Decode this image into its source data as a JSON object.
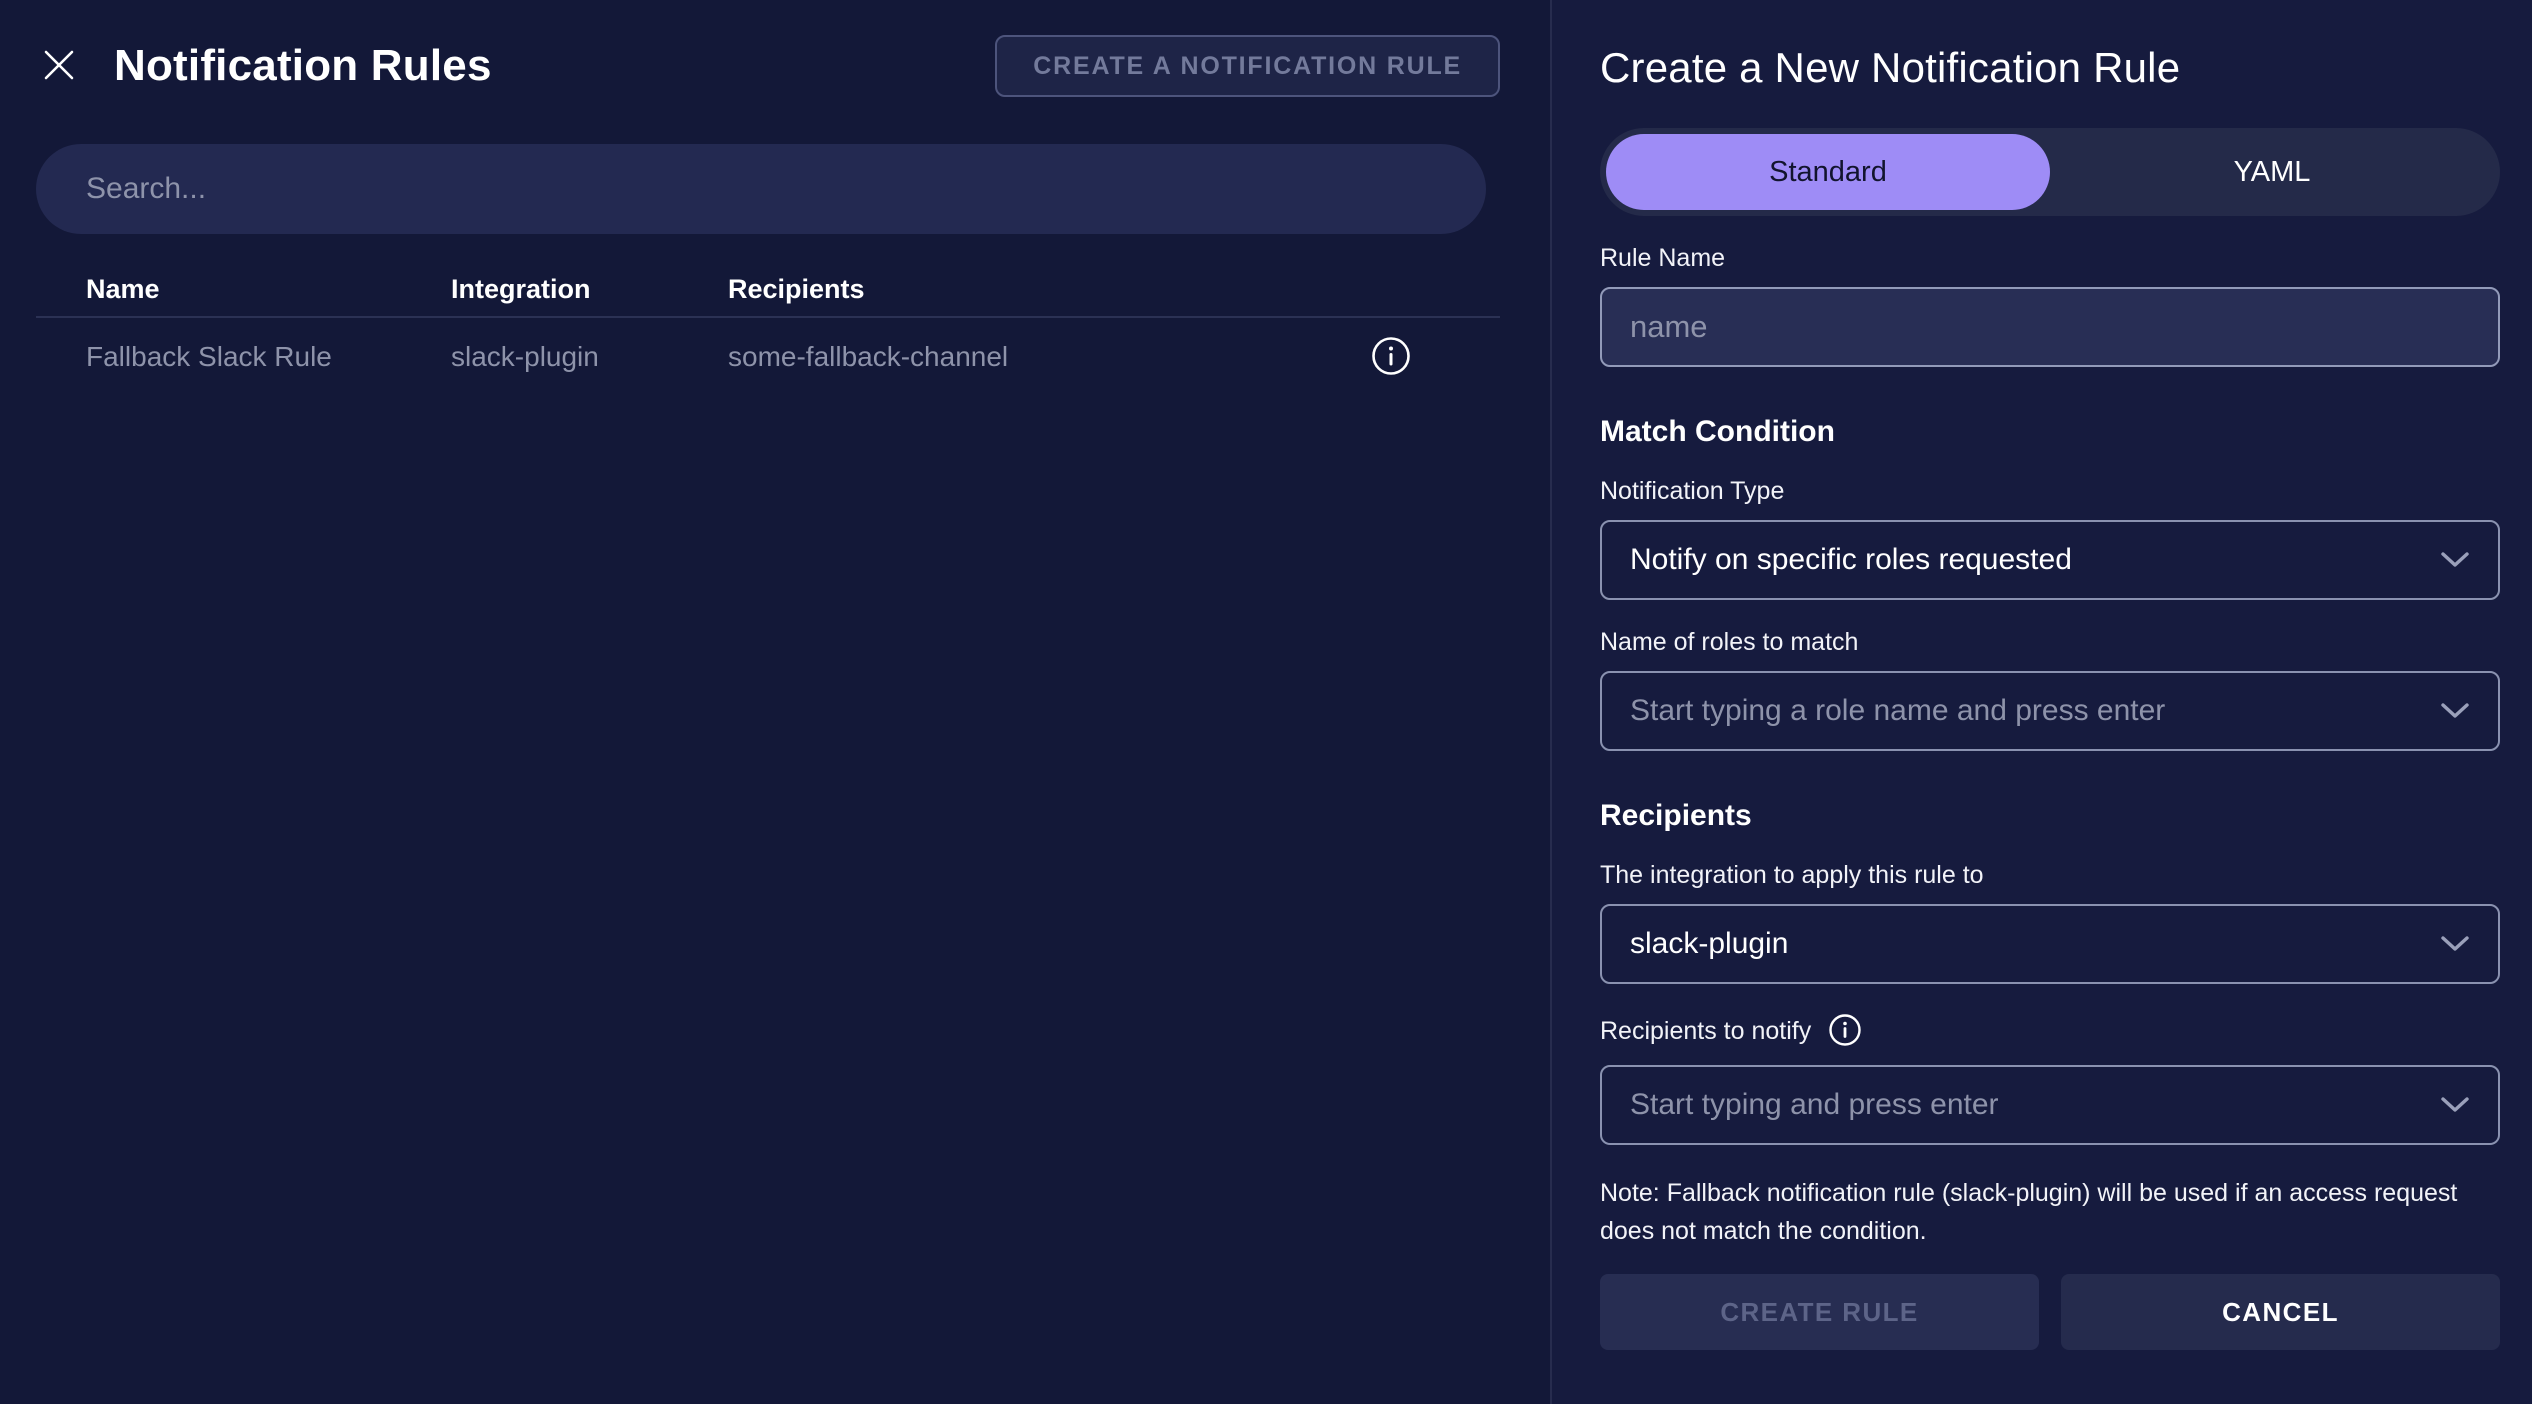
{
  "colors": {
    "purple": "#9e8cf6",
    "bg-left": "#131838",
    "bg-right": "#161b3e",
    "muted": "#8e93aa",
    "border": "#8e96b4"
  },
  "left_panel": {
    "title": "Notification Rules",
    "create_button_label": "CREATE A NOTIFICATION RULE",
    "search_placeholder": "Search...",
    "table": {
      "columns": [
        "Name",
        "Integration",
        "Recipients"
      ],
      "rows": [
        {
          "name": "Fallback Slack Rule",
          "integration": "slack-plugin",
          "recipients": "some-fallback-channel"
        }
      ]
    }
  },
  "right_panel": {
    "title": "Create a New Notification Rule",
    "tabs": [
      {
        "label": "Standard",
        "active": true
      },
      {
        "label": "YAML",
        "active": false
      }
    ],
    "rule_name": {
      "label": "Rule Name",
      "placeholder": "name"
    },
    "match_condition": {
      "heading": "Match Condition",
      "notification_type": {
        "label": "Notification Type",
        "value": "Notify on specific roles requested"
      },
      "roles": {
        "label": "Name of roles to match",
        "placeholder": "Start typing a role name and press enter"
      }
    },
    "recipients": {
      "heading": "Recipients",
      "integration": {
        "label": "The integration to apply this rule to",
        "value": "slack-plugin"
      },
      "notify": {
        "label": "Recipients to notify",
        "placeholder": "Start typing and press enter"
      }
    },
    "note": "Note: Fallback notification rule (slack-plugin) will be used if an access request does not match the condition.",
    "create_rule_label": "CREATE RULE",
    "cancel_label": "CANCEL"
  }
}
